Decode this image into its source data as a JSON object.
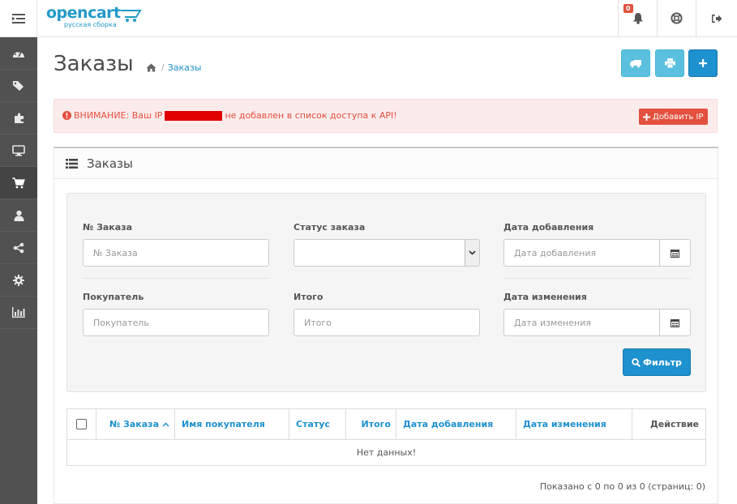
{
  "header": {
    "logo_text": "opencart",
    "logo_subtitle": "русская сборка",
    "notification_count": "0"
  },
  "sidebar": {
    "items": [
      {
        "icon": "dashboard-icon",
        "active": false
      },
      {
        "icon": "tags-icon",
        "active": false
      },
      {
        "icon": "puzzle-icon",
        "active": false
      },
      {
        "icon": "desktop-icon",
        "active": false
      },
      {
        "icon": "shopping-cart-icon",
        "active": true
      },
      {
        "icon": "user-icon",
        "active": false
      },
      {
        "icon": "share-icon",
        "active": false
      },
      {
        "icon": "cog-icon",
        "active": false
      },
      {
        "icon": "bar-chart-icon",
        "active": false
      }
    ]
  },
  "page": {
    "title": "Заказы",
    "breadcrumb_current": "Заказы",
    "breadcrumb_sep": "/"
  },
  "alert": {
    "text_before": "ВНИМАНИЕ: Ваш IP",
    "text_after": "не добавлен в список доступа к API!",
    "add_ip_label": "Добавить IP"
  },
  "panel": {
    "title": "Заказы"
  },
  "filter": {
    "order_id_label": "№ Заказа",
    "order_id_placeholder": "№ Заказа",
    "status_label": "Статус заказа",
    "status_value": "",
    "date_added_label": "Дата добавления",
    "date_added_placeholder": "Дата добавления",
    "customer_label": "Покупатель",
    "customer_placeholder": "Покупатель",
    "total_label": "Итого",
    "total_placeholder": "Итого",
    "date_modified_label": "Дата изменения",
    "date_modified_placeholder": "Дата изменения",
    "filter_button": "Фильтр"
  },
  "table": {
    "columns": [
      "№ Заказа",
      "Имя покупателя",
      "Статус",
      "Итого",
      "Дата добавления",
      "Дата изменения",
      "Действие"
    ],
    "empty_text": "Нет данных!",
    "pagination_info": "Показано с 0 по 0 из 0 (страниц: 0)"
  },
  "colors": {
    "primary": "#1e91cf",
    "info": "#5bc0de",
    "danger": "#e3503e",
    "sidebar": "#515151"
  }
}
